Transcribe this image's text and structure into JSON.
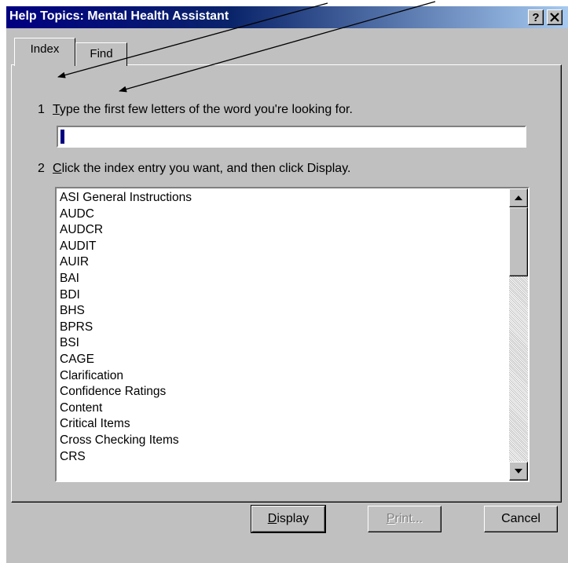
{
  "window": {
    "title": "Help Topics: Mental Health Assistant",
    "help_button": "?",
    "close_button": "✕"
  },
  "tabs": [
    {
      "label": "Index",
      "active": true
    },
    {
      "label": "Find",
      "active": false
    }
  ],
  "steps": {
    "step1_number": "1",
    "step1_first": "T",
    "step1_rest": "ype the first few letters of the word you're looking for.",
    "step2_number": "2",
    "step2_first": "C",
    "step2_rest": "lick the index entry you want, and then click Display."
  },
  "search": {
    "value": ""
  },
  "index_list": [
    "ASI General Instructions",
    "AUDC",
    "AUDCR",
    "AUDIT",
    "AUIR",
    "BAI",
    "BDI",
    "BHS",
    "BPRS",
    "BSI",
    "CAGE",
    "Clarification",
    "Confidence Ratings",
    "Content",
    "Critical Items",
    "Cross Checking Items",
    "CRS"
  ],
  "buttons": {
    "display_first": "D",
    "display_rest": "isplay",
    "print_first": "P",
    "print_rest": "rint...",
    "cancel": "Cancel"
  }
}
